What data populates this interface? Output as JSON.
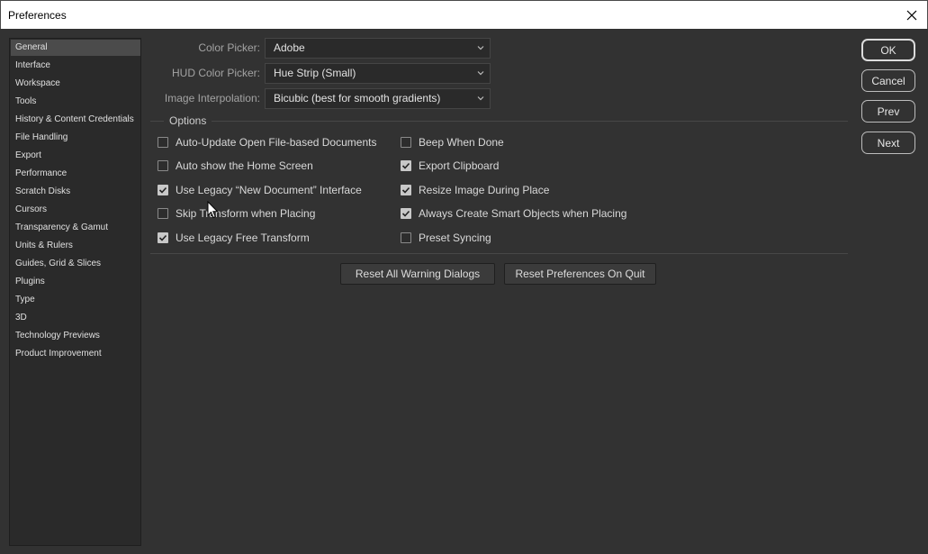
{
  "window": {
    "title": "Preferences"
  },
  "sidebar": {
    "items": [
      {
        "label": "General",
        "selected": true
      },
      {
        "label": "Interface"
      },
      {
        "label": "Workspace"
      },
      {
        "label": "Tools"
      },
      {
        "label": "History & Content Credentials"
      },
      {
        "label": "File Handling"
      },
      {
        "label": "Export"
      },
      {
        "label": "Performance"
      },
      {
        "label": "Scratch Disks"
      },
      {
        "label": "Cursors"
      },
      {
        "label": "Transparency & Gamut"
      },
      {
        "label": "Units & Rulers"
      },
      {
        "label": "Guides, Grid & Slices"
      },
      {
        "label": "Plugins"
      },
      {
        "label": "Type"
      },
      {
        "label": "3D"
      },
      {
        "label": "Technology Previews"
      },
      {
        "label": "Product Improvement"
      }
    ]
  },
  "fields": {
    "color_picker": {
      "label": "Color Picker:",
      "value": "Adobe"
    },
    "hud_color_picker": {
      "label": "HUD Color Picker:",
      "value": "Hue Strip (Small)"
    },
    "image_interpolation": {
      "label": "Image Interpolation:",
      "value": "Bicubic (best for smooth gradients)"
    }
  },
  "options": {
    "legend": "Options",
    "left": [
      {
        "label": "Auto-Update Open File-based Documents",
        "checked": false
      },
      {
        "label": "Auto show the Home Screen",
        "checked": false
      },
      {
        "label": "Use Legacy “New Document” Interface",
        "checked": true
      },
      {
        "label": "Skip Transform when Placing",
        "checked": false
      },
      {
        "label": "Use Legacy Free Transform",
        "checked": true
      }
    ],
    "right": [
      {
        "label": "Beep When Done",
        "checked": false
      },
      {
        "label": "Export Clipboard",
        "checked": true
      },
      {
        "label": "Resize Image During Place",
        "checked": true
      },
      {
        "label": "Always Create Smart Objects when Placing",
        "checked": true
      },
      {
        "label": "Preset Syncing",
        "checked": false
      }
    ]
  },
  "buttons": {
    "reset_warnings": "Reset All Warning Dialogs",
    "reset_prefs": "Reset Preferences On Quit",
    "ok": "OK",
    "cancel": "Cancel",
    "prev": "Prev",
    "next": "Next"
  },
  "colors": {
    "background": "#323232",
    "sidebar_bg": "#2a2a2a",
    "selected_item": "#4b4b4b",
    "titlebar": "#ffffff"
  }
}
